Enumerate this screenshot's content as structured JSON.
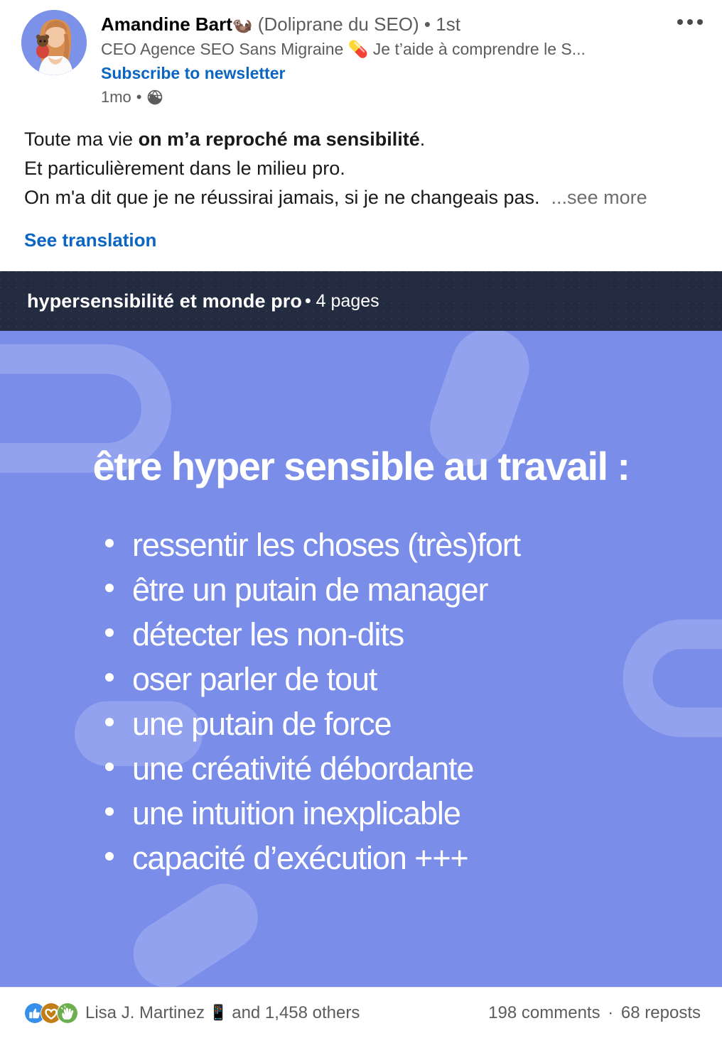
{
  "post": {
    "author": {
      "name": "Amandine Bart",
      "name_emoji": "🦦",
      "tagline": "(Doliprane du SEO)",
      "degree": "• 1st",
      "headline": "CEO Agence SEO Sans Migraine 💊 Je t’aide à comprendre le S...",
      "newsletter_cta": "Subscribe to newsletter",
      "timestamp": "1mo",
      "meta_separator": "•",
      "visibility_icon": "globe-icon"
    },
    "overflow_icon": "ellipsis-icon",
    "text": {
      "line1_prefix": "Toute ma vie ",
      "line1_bold": "on m’a reproché ma sensibilité",
      "line1_suffix": ".",
      "line2": "Et particulièrement dans le milieu pro.",
      "line3": "On m'a dit que je ne réussirai jamais, si je ne changeais pas.",
      "see_more": "...see more",
      "see_translation": "See translation"
    }
  },
  "document": {
    "title": "hypersensibilité et monde pro",
    "pages_label": "• 4 pages",
    "titlebar_color": "#232b40",
    "slide": {
      "background_color": "#7a8de9",
      "decor_color": "#93a2ee",
      "text_color": "#ffffff",
      "heading": "être hyper sensible au travail :",
      "bullets": [
        "ressentir les choses (très)fort",
        "être un putain de manager",
        "détecter les non-dits",
        "oser parler de tout",
        "une putain de force",
        "une créativité débordante",
        "une intuition inexplicable",
        "capacité d’exécution +++"
      ]
    }
  },
  "social": {
    "reaction_icons": [
      "like-thumbs-up-icon",
      "love-heart-icon",
      "celebrate-clap-icon"
    ],
    "reactor_name": "Lisa J. Martinez",
    "reactor_emoji": "📱",
    "others_text": "and 1,458 others",
    "comments": "198 comments",
    "separator": "·",
    "reposts": "68 reposts"
  },
  "colors": {
    "linkedin_blue": "#0a66c2",
    "text_primary": "#191919",
    "text_secondary": "#5c5c5c",
    "slide_purple": "#7a8de9",
    "navy": "#232b40"
  }
}
